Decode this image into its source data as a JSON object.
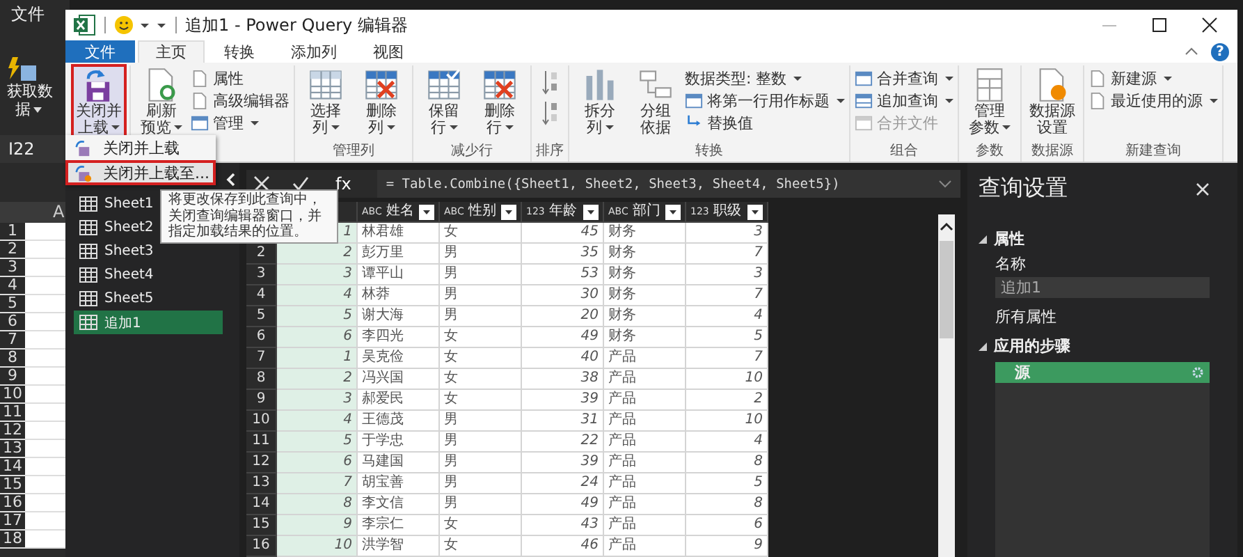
{
  "excel": {
    "file_tab": "文件",
    "get_data": [
      "获取数",
      "据"
    ],
    "name_box": "I22",
    "column": "A",
    "rows": [
      "1",
      "2",
      "3",
      "4",
      "5",
      "6",
      "7",
      "8",
      "9",
      "10",
      "11",
      "12",
      "13",
      "14",
      "15",
      "16",
      "17",
      "18"
    ]
  },
  "window": {
    "title": "追加1 - Power Query 编辑器",
    "help": "?"
  },
  "tabs": [
    {
      "label": "文件",
      "kind": "file",
      "selected": false
    },
    {
      "label": "主页",
      "kind": "tab",
      "selected": true
    },
    {
      "label": "转换",
      "kind": "tab",
      "selected": false
    },
    {
      "label": "添加列",
      "kind": "tab",
      "selected": false
    },
    {
      "label": "视图",
      "kind": "tab",
      "selected": false
    }
  ],
  "ribbon": {
    "groups": [
      {
        "items": [
          {
            "kind": "big",
            "lines": [
              "关闭并",
              "上载"
            ],
            "dropdown": true,
            "highlighted": true
          }
        ]
      },
      {
        "items": [
          {
            "kind": "big",
            "lines": [
              "刷新",
              "预览"
            ],
            "dropdown": true,
            "highlighted": false
          },
          {
            "kind": "stack",
            "items": [
              {
                "label": "属性",
                "dropdown": false,
                "disabled": false
              },
              {
                "label": "高级编辑器",
                "dropdown": false,
                "disabled": false
              },
              {
                "label": "管理",
                "dropdown": true,
                "disabled": false
              }
            ]
          }
        ]
      },
      {
        "label": "管理列",
        "items": [
          {
            "kind": "big",
            "lines": [
              "选择",
              "列"
            ],
            "dropdown": true,
            "highlighted": false
          },
          {
            "kind": "big",
            "lines": [
              "删除",
              "列"
            ],
            "dropdown": true,
            "highlighted": false
          }
        ]
      },
      {
        "label": "减少行",
        "items": [
          {
            "kind": "big",
            "lines": [
              "保留",
              "行"
            ],
            "dropdown": true,
            "highlighted": false
          },
          {
            "kind": "big",
            "lines": [
              "删除",
              "行"
            ],
            "dropdown": true,
            "highlighted": false
          }
        ]
      },
      {
        "label": "排序",
        "items": [
          {
            "kind": "sort"
          }
        ]
      },
      {
        "label": "转换",
        "items": [
          {
            "kind": "big",
            "lines": [
              "拆分",
              "列"
            ],
            "dropdown": true,
            "highlighted": false
          },
          {
            "kind": "big",
            "lines": [
              "分组",
              "依据"
            ],
            "dropdown": false,
            "highlighted": false
          },
          {
            "kind": "stack",
            "items": [
              {
                "label": "数据类型: 整数",
                "dropdown": true,
                "disabled": false
              },
              {
                "label": "将第一行用作标题",
                "dropdown": true,
                "disabled": false
              },
              {
                "label": "替换值",
                "dropdown": false,
                "disabled": false
              }
            ]
          }
        ]
      },
      {
        "label": "组合",
        "items": [
          {
            "kind": "stack",
            "items": [
              {
                "label": "合并查询",
                "dropdown": true,
                "disabled": false
              },
              {
                "label": "追加查询",
                "dropdown": true,
                "disabled": false
              },
              {
                "label": "合并文件",
                "dropdown": false,
                "disabled": true
              }
            ]
          }
        ]
      },
      {
        "label": "参数",
        "items": [
          {
            "kind": "big",
            "lines": [
              "管理",
              "参数"
            ],
            "dropdown": true,
            "highlighted": false
          }
        ]
      },
      {
        "label": "数据源",
        "items": [
          {
            "kind": "big",
            "lines": [
              "数据源",
              "设置"
            ],
            "dropdown": false,
            "highlighted": false
          }
        ]
      },
      {
        "label": "新建查询",
        "items": [
          {
            "kind": "stack",
            "items": [
              {
                "label": "新建源",
                "dropdown": true,
                "disabled": false
              },
              {
                "label": "最近使用的源",
                "dropdown": true,
                "disabled": false
              }
            ]
          }
        ]
      }
    ]
  },
  "menu": {
    "items": [
      {
        "label": "关闭并上载",
        "selected": false,
        "highlighted": false
      },
      {
        "label": "关闭并上载至...",
        "selected": true,
        "highlighted": true
      }
    ]
  },
  "tooltip": "将更改保存到此查询中，关闭查询编辑器窗口，并指定加载结果的位置。",
  "queries": [
    {
      "label": "Sheet1",
      "selected": false
    },
    {
      "label": "Sheet2",
      "selected": false
    },
    {
      "label": "Sheet3",
      "selected": false
    },
    {
      "label": "Sheet4",
      "selected": false
    },
    {
      "label": "Sheet5",
      "selected": false
    },
    {
      "label": "追加1",
      "selected": true
    }
  ],
  "formula": {
    "fx": "fx",
    "text": "= Table.Combine({Sheet1, Sheet2, Sheet3, Sheet4, Sheet5})"
  },
  "table": {
    "columns": [
      {
        "label": "姓名",
        "type_label": "ABC",
        "kind": "text"
      },
      {
        "label": "性别",
        "type_label": "ABC",
        "kind": "text"
      },
      {
        "label": "年龄",
        "type_label": "123",
        "kind": "number"
      },
      {
        "label": "部门",
        "type_label": "ABC",
        "kind": "text"
      },
      {
        "label": "职级",
        "type_label": "123",
        "kind": "number"
      }
    ],
    "rows": [
      {
        "index": "1",
        "cells": [
          "林君雄",
          "女",
          "45",
          "财务",
          "3"
        ]
      },
      {
        "n": "2",
        "index": "2",
        "cells": [
          "彭万里",
          "男",
          "35",
          "财务",
          "7"
        ]
      },
      {
        "n": "3",
        "index": "3",
        "cells": [
          "谭平山",
          "男",
          "53",
          "财务",
          "3"
        ]
      },
      {
        "n": "4",
        "index": "4",
        "cells": [
          "林莽",
          "男",
          "30",
          "财务",
          "7"
        ]
      },
      {
        "n": "5",
        "index": "5",
        "cells": [
          "谢大海",
          "男",
          "20",
          "财务",
          "4"
        ]
      },
      {
        "n": "6",
        "index": "6",
        "cells": [
          "李四光",
          "女",
          "49",
          "财务",
          "5"
        ]
      },
      {
        "n": "7",
        "index": "1",
        "cells": [
          "吴克俭",
          "女",
          "40",
          "产品",
          "7"
        ]
      },
      {
        "n": "8",
        "index": "2",
        "cells": [
          "冯兴国",
          "女",
          "38",
          "产品",
          "10"
        ]
      },
      {
        "n": "9",
        "index": "3",
        "cells": [
          "郝爱民",
          "女",
          "39",
          "产品",
          "2"
        ]
      },
      {
        "n": "10",
        "index": "4",
        "cells": [
          "王德茂",
          "男",
          "31",
          "产品",
          "10"
        ]
      },
      {
        "n": "11",
        "index": "5",
        "cells": [
          "于学忠",
          "男",
          "22",
          "产品",
          "4"
        ]
      },
      {
        "n": "12",
        "index": "6",
        "cells": [
          "马建国",
          "男",
          "39",
          "产品",
          "8"
        ]
      },
      {
        "n": "13",
        "index": "7",
        "cells": [
          "胡宝善",
          "男",
          "24",
          "产品",
          "5"
        ]
      },
      {
        "n": "14",
        "index": "8",
        "cells": [
          "李文信",
          "男",
          "49",
          "产品",
          "8"
        ]
      },
      {
        "n": "15",
        "index": "9",
        "cells": [
          "李宗仁",
          "女",
          "43",
          "产品",
          "6"
        ]
      },
      {
        "n": "16",
        "index": "10",
        "cells": [
          "洪学智",
          "女",
          "46",
          "产品",
          "9"
        ]
      }
    ]
  },
  "settings": {
    "title": "查询设置",
    "properties_heading": "属性",
    "name_label": "名称",
    "name_value": "追加1",
    "all_properties": "所有属性",
    "steps_heading": "应用的步骤",
    "steps": [
      {
        "label": "源",
        "selected": true
      }
    ]
  }
}
